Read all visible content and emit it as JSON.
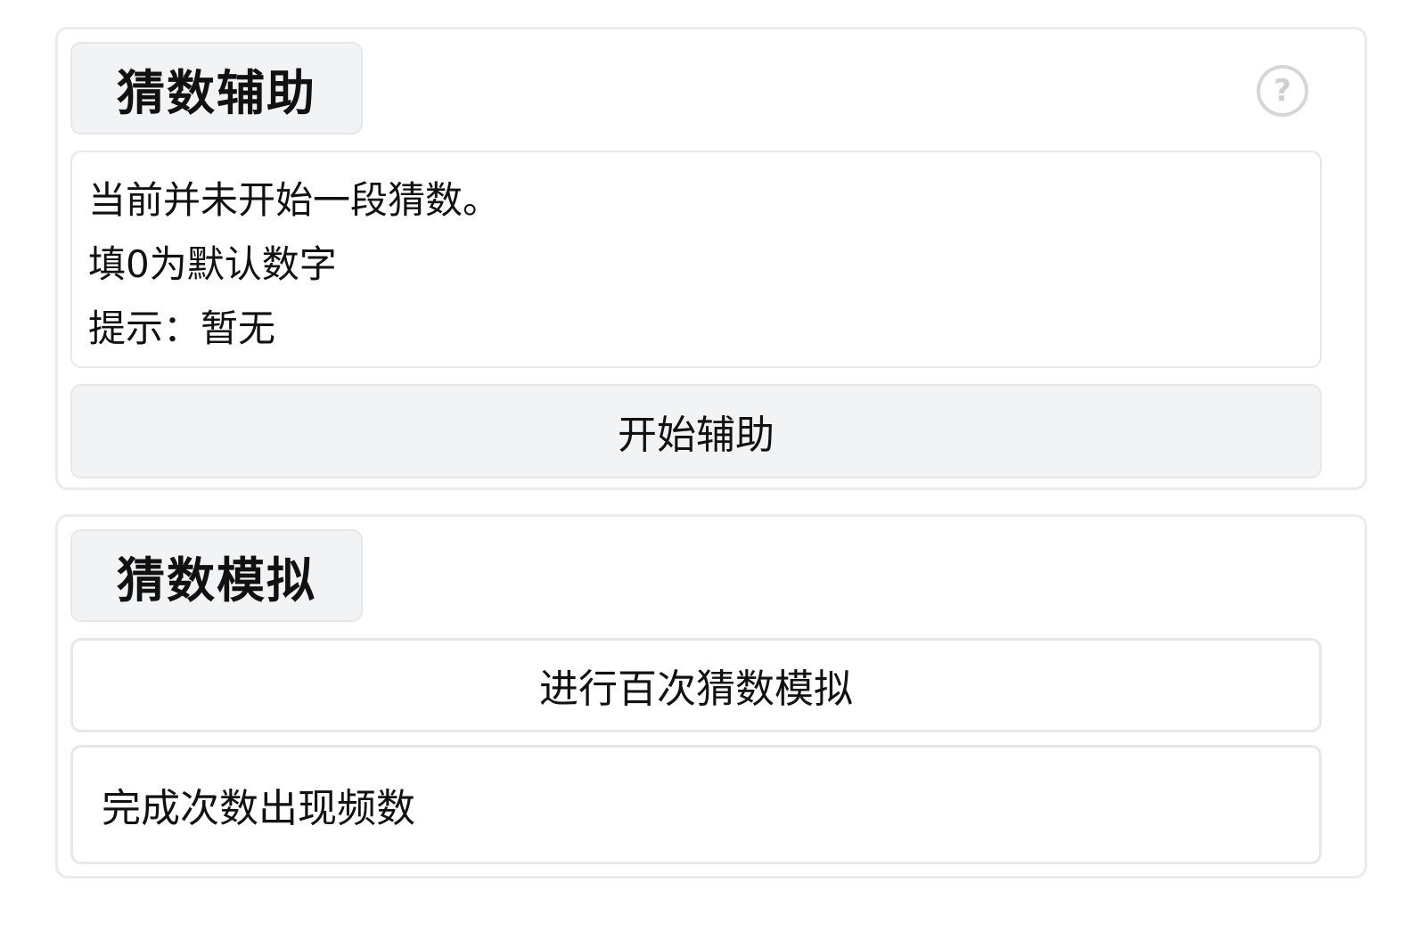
{
  "assist": {
    "title": "猜数辅助",
    "help_icon": "question-circle-icon",
    "help_glyph": "?",
    "info_lines": [
      "当前并未开始一段猜数。",
      "填0为默认数字",
      "提示：暂无"
    ],
    "start_button_label": "开始辅助"
  },
  "simulation": {
    "title": "猜数模拟",
    "simulate_button_label": "进行百次猜数模拟",
    "result_header": "完成次数出现频数"
  },
  "colors": {
    "card_border": "#ebebeb",
    "tab_background": "#f2f3f5",
    "button_background": "#f2f3f5",
    "help_icon": "#d6d6d6",
    "text": "#111111"
  }
}
